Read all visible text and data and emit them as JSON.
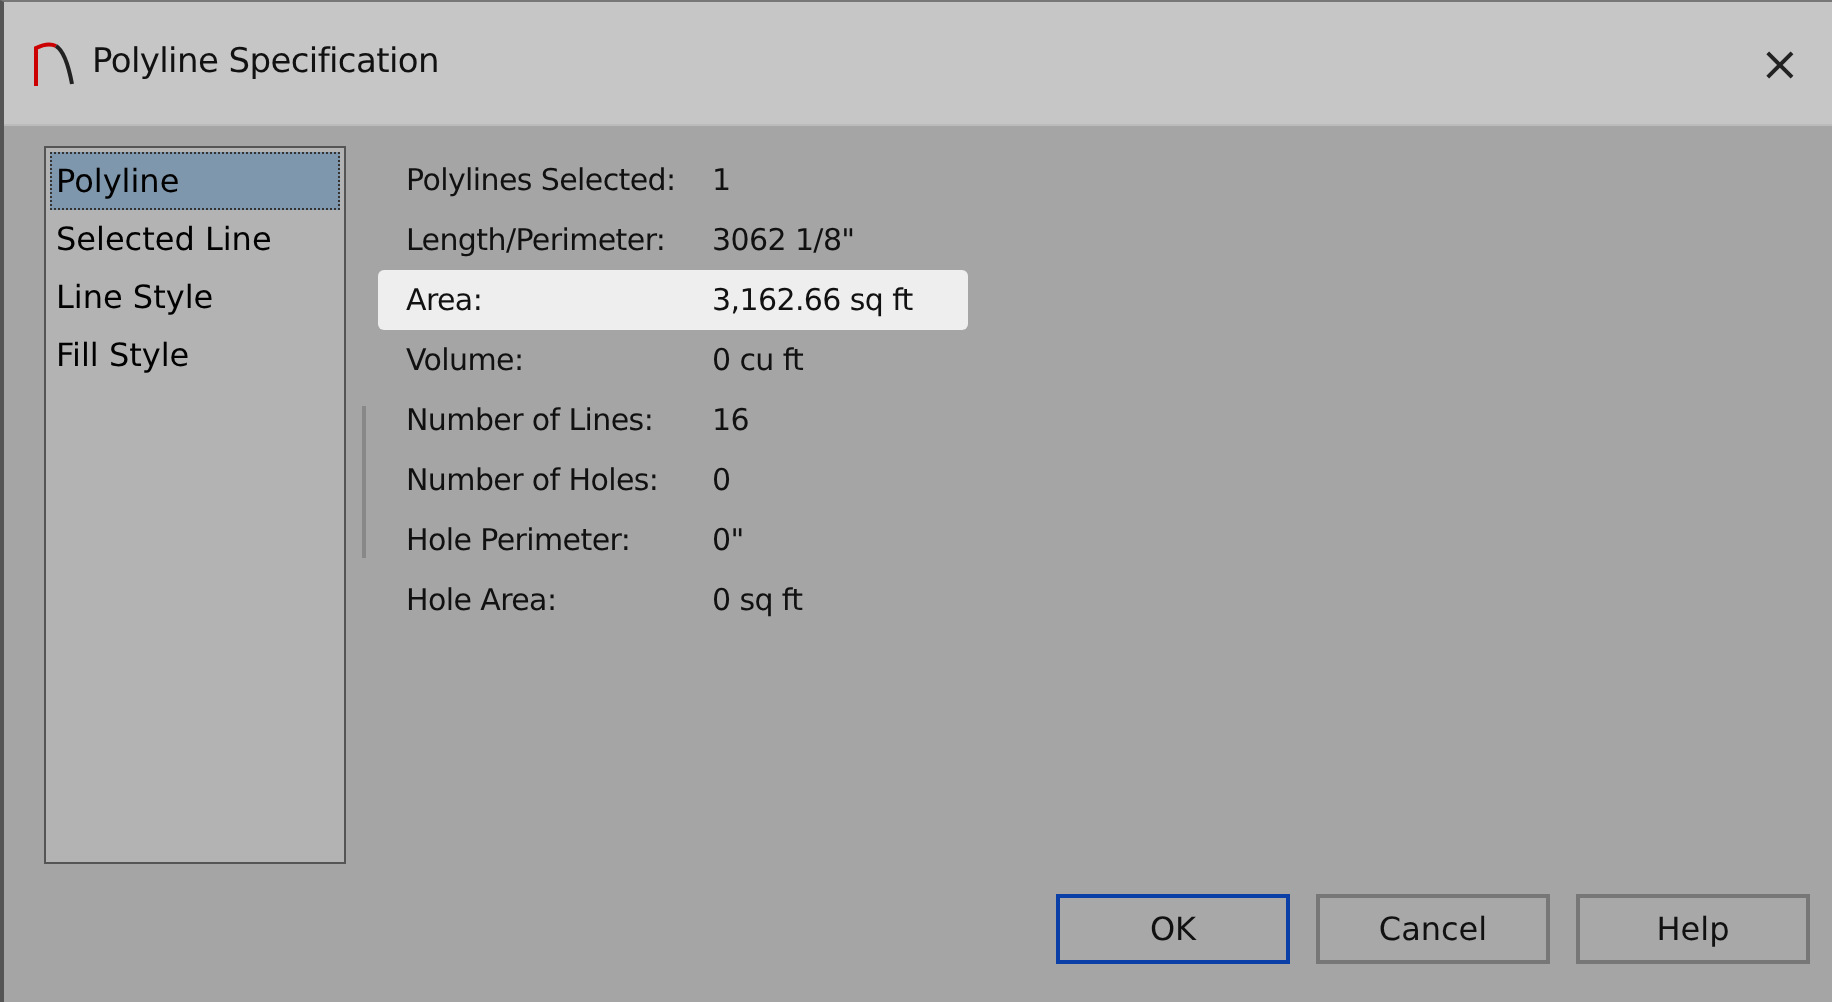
{
  "window": {
    "title": "Polyline Specification",
    "close": "×"
  },
  "sidebar": {
    "items": [
      {
        "label": "Polyline",
        "selected": true
      },
      {
        "label": "Selected Line",
        "selected": false
      },
      {
        "label": "Line Style",
        "selected": false
      },
      {
        "label": "Fill Style",
        "selected": false
      }
    ]
  },
  "properties": [
    {
      "label": "Polylines Selected:",
      "value": "1",
      "highlighted": false
    },
    {
      "label": "Length/Perimeter:",
      "value": "3062 1/8\"",
      "highlighted": false
    },
    {
      "label": "Area:",
      "value": "3,162.66 sq ft",
      "highlighted": true
    },
    {
      "label": "Volume:",
      "value": "0 cu ft",
      "highlighted": false
    },
    {
      "label": "Number of Lines:",
      "value": "16",
      "highlighted": false
    },
    {
      "label": "Number of Holes:",
      "value": "0",
      "highlighted": false
    },
    {
      "label": "Hole Perimeter:",
      "value": "0\"",
      "highlighted": false
    },
    {
      "label": "Hole Area:",
      "value": "0 sq ft",
      "highlighted": false
    }
  ],
  "buttons": [
    {
      "label": "OK",
      "default": true
    },
    {
      "label": "Cancel",
      "default": false
    },
    {
      "label": "Help",
      "default": false
    }
  ]
}
